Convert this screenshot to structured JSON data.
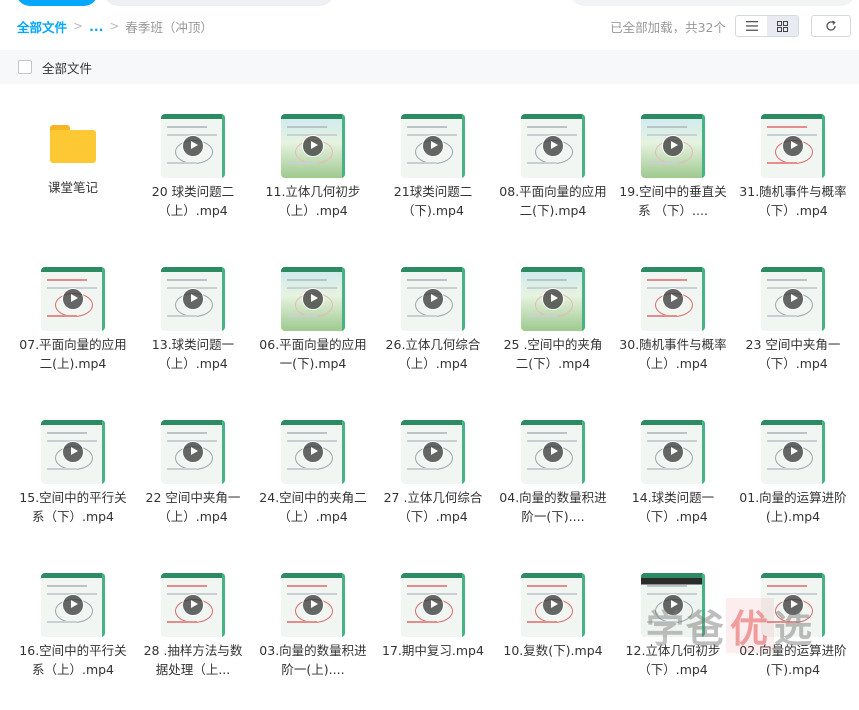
{
  "breadcrumb": {
    "root": "全部文件",
    "ellipsis": "...",
    "current": "春季班（冲顶）"
  },
  "status": "已全部加载，共32个",
  "toolbar": {
    "list_icon": "list-icon",
    "grid_icon": "grid-icon",
    "refresh_icon": "refresh-icon"
  },
  "select_all_label": "全部文件",
  "colors": {
    "accent": "#06a7ff",
    "folder": "#fcc934",
    "thumb_green": "#2c8b63"
  },
  "files": [
    {
      "name": "课堂笔记",
      "type": "folder"
    },
    {
      "name": "20 球类问题二（上）.mp4",
      "type": "video",
      "style": ""
    },
    {
      "name": "11.立体几何初步（上）.mp4",
      "type": "video",
      "style": "scenic"
    },
    {
      "name": "21球类问题二（下).mp4",
      "type": "video",
      "style": ""
    },
    {
      "name": "08.平面向量的应用二(下).mp4",
      "type": "video",
      "style": ""
    },
    {
      "name": "19.空间中的垂直关系 （下）....",
      "type": "video",
      "style": "scenic"
    },
    {
      "name": "31.随机事件与概率（下）.mp4",
      "type": "video",
      "style": "redink"
    },
    {
      "name": "07.平面向量的应用二(上).mp4",
      "type": "video",
      "style": "redink"
    },
    {
      "name": "13.球类问题一（上）.mp4",
      "type": "video",
      "style": ""
    },
    {
      "name": "06.平面向量的应用一(下).mp4",
      "type": "video",
      "style": "scenic"
    },
    {
      "name": "26.立体几何综合（上）.mp4",
      "type": "video",
      "style": ""
    },
    {
      "name": "25 .空间中的夹角二(下）.mp4",
      "type": "video",
      "style": "scenic"
    },
    {
      "name": "30.随机事件与概率（上）.mp4",
      "type": "video",
      "style": "redink"
    },
    {
      "name": "23 空间中夹角一（下）.mp4",
      "type": "video",
      "style": ""
    },
    {
      "name": "15.空间中的平行关系（下）.mp4",
      "type": "video",
      "style": ""
    },
    {
      "name": "22 空间中夹角一（上）.mp4",
      "type": "video",
      "style": ""
    },
    {
      "name": "24.空间中的夹角二（上）.mp4",
      "type": "video",
      "style": ""
    },
    {
      "name": "27 .立体几何综合（下）.mp4",
      "type": "video",
      "style": ""
    },
    {
      "name": "04.向量的数量积进阶一(下)....",
      "type": "video",
      "style": ""
    },
    {
      "name": "14.球类问题一（下）.mp4",
      "type": "video",
      "style": ""
    },
    {
      "name": "01.向量的运算进阶(上).mp4",
      "type": "video",
      "style": ""
    },
    {
      "name": "16.空间中的平行关系（上）.mp4",
      "type": "video",
      "style": ""
    },
    {
      "name": "28 .抽样方法与数据处理（上...",
      "type": "video",
      "style": "redink"
    },
    {
      "name": "03.向量的数量积进阶一(上)....",
      "type": "video",
      "style": "redink"
    },
    {
      "name": "17.期中复习.mp4",
      "type": "video",
      "style": "redink"
    },
    {
      "name": "10.复数(下).mp4",
      "type": "video",
      "style": "redink"
    },
    {
      "name": "12.立体几何初步（下）.mp4",
      "type": "video",
      "style": "dark"
    },
    {
      "name": "02.向量的运算进阶(下).mp4",
      "type": "video",
      "style": "redink"
    }
  ],
  "watermark": [
    "学",
    "爸",
    "优",
    "选"
  ]
}
